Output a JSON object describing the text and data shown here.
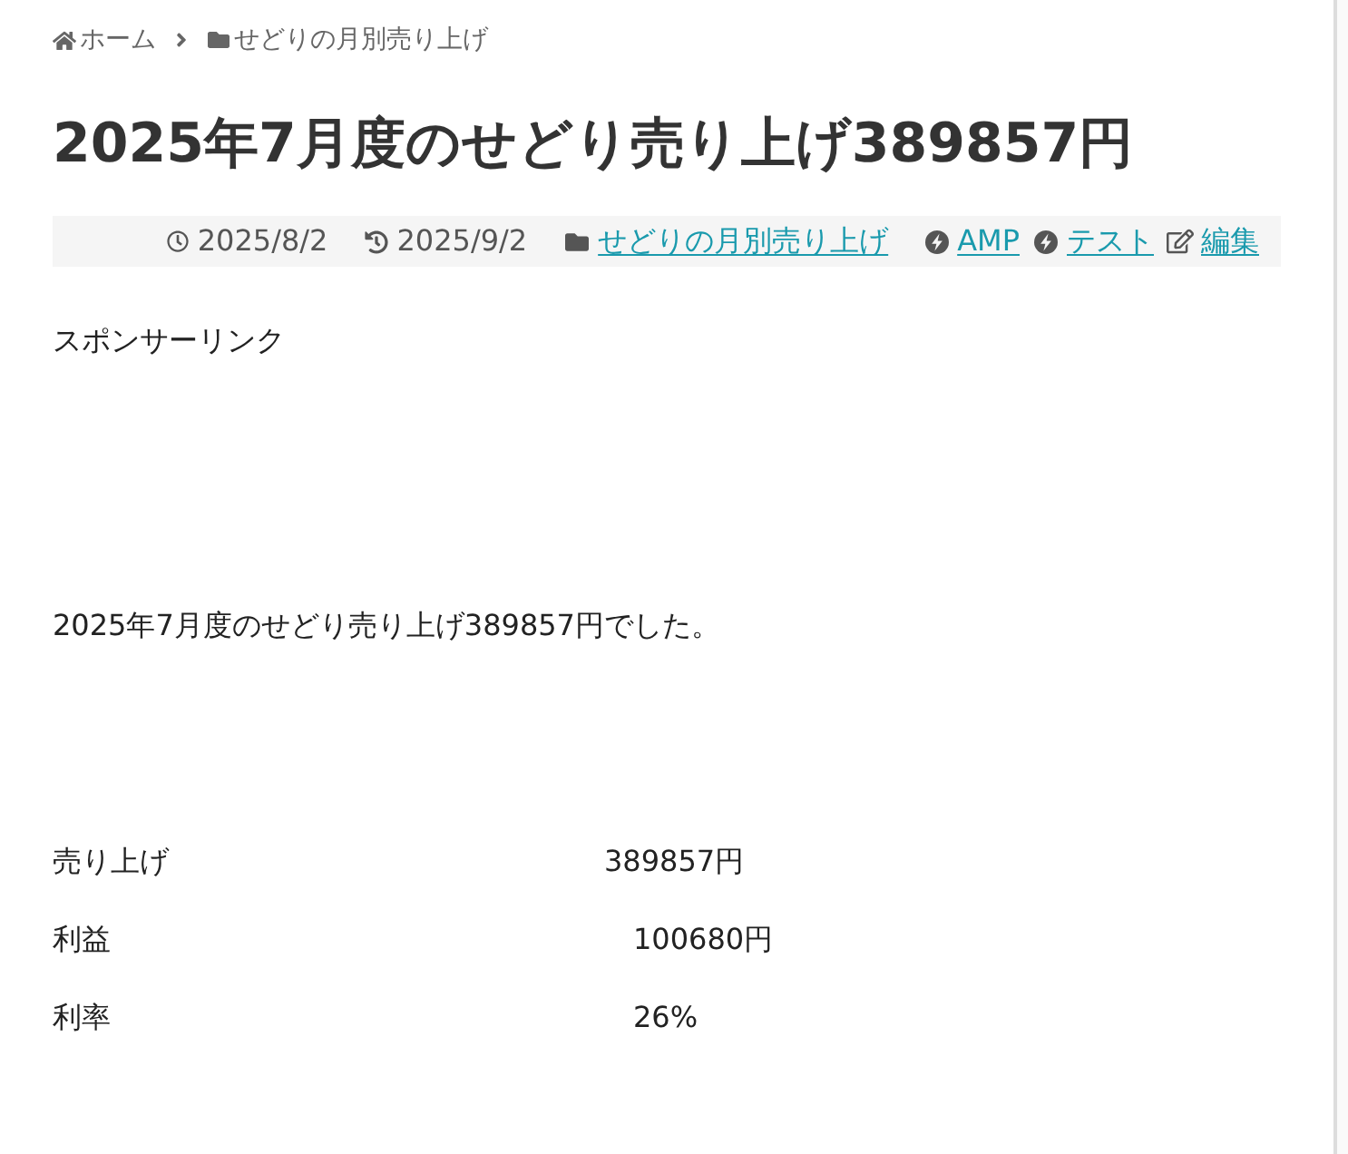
{
  "breadcrumb": [
    {
      "kind": "home",
      "label": "ホーム"
    },
    {
      "kind": "category",
      "label": "せどりの月別売り上げ"
    }
  ],
  "article": {
    "title": "2025年7月度のせどり売り上げ389857円",
    "meta": [
      {
        "kind": "published",
        "text": "2025/8/2"
      },
      {
        "kind": "updated",
        "text": "2025/9/2"
      },
      {
        "kind": "category",
        "text": "せどりの月別売り上げ"
      },
      {
        "kind": "tag",
        "text": "AMP"
      },
      {
        "kind": "tag",
        "text": "テスト"
      },
      {
        "kind": "edit",
        "text": "編集"
      }
    ],
    "sponsor_label": "スポンサーリンク",
    "body": "2025年7月度のせどり売り上げ389857円でした。",
    "summary_rows": [
      {
        "label": "売り上げ",
        "value": "389857円"
      },
      {
        "label": "利益",
        "value": "100680円"
      },
      {
        "label": "利率",
        "value": "26%"
      }
    ]
  }
}
